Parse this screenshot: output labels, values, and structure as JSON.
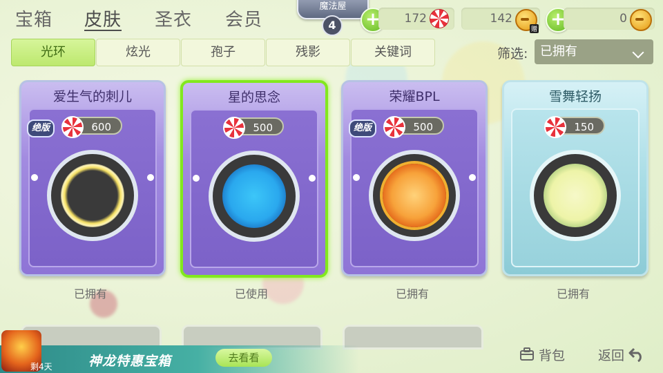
{
  "nav": {
    "tabs": [
      {
        "label": "宝箱"
      },
      {
        "label": "皮肤"
      },
      {
        "label": "圣衣"
      },
      {
        "label": "会员"
      }
    ],
    "active_tab": "皮肤"
  },
  "magic_house": {
    "label": "魔法屋",
    "level": "4"
  },
  "currencies": {
    "candy": {
      "value": "172"
    },
    "coins": {
      "value": "142",
      "badge": "赠"
    },
    "gold": {
      "value": "0"
    }
  },
  "sub_tabs": [
    {
      "label": "光环"
    },
    {
      "label": "炫光"
    },
    {
      "label": "孢子"
    },
    {
      "label": "残影"
    },
    {
      "label": "关键词"
    }
  ],
  "filter": {
    "label": "筛选:",
    "selected": "已拥有"
  },
  "cards": [
    {
      "title": "爱生气的刺儿",
      "price": "600",
      "limited_badge": "绝版",
      "status": "已拥有",
      "theme": "purple",
      "ring_color": "#f2d64a"
    },
    {
      "title": "星的思念",
      "price": "500",
      "limited_badge": "",
      "status": "已使用",
      "theme": "purple",
      "ring_color": "#2ab6f0"
    },
    {
      "title": "荣耀BPL",
      "price": "500",
      "limited_badge": "绝版",
      "status": "已拥有",
      "theme": "purple",
      "ring_color": "#f5892a"
    },
    {
      "title": "雪舞轻扬",
      "price": "150",
      "limited_badge": "",
      "status": "已拥有",
      "theme": "ice",
      "ring_color": "#f2f6b2"
    }
  ],
  "promo": {
    "title": "神龙特惠宝箱",
    "button": "去看看",
    "days_left": "剩4天"
  },
  "bottom": {
    "bag_label": "背包",
    "back_label": "返回"
  },
  "colors": {
    "accent_green": "#82e81e",
    "card_purple": "#8e74d6",
    "card_ice": "#8ccbd6"
  }
}
